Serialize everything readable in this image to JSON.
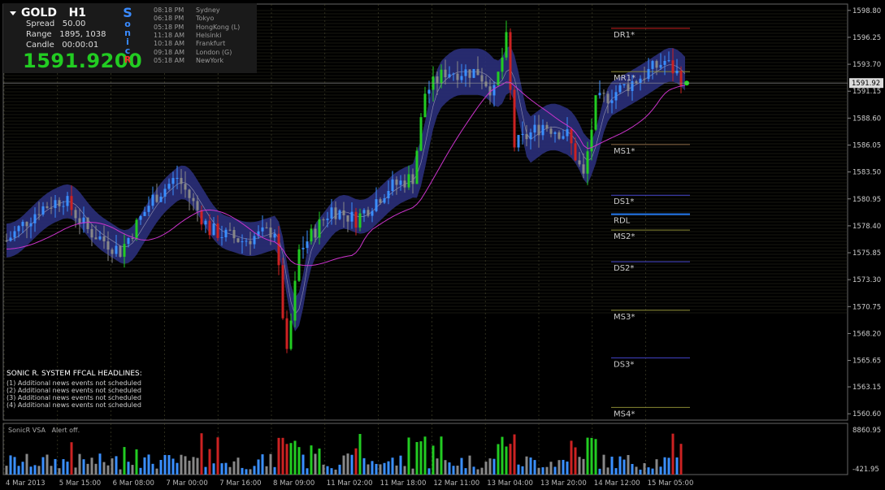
{
  "header": {
    "symbol": "GOLD",
    "timeframe": "H1",
    "spread_label": "Spread",
    "spread_value": "50.00",
    "range_label": "Range",
    "range_value": "1895, 1038",
    "candle_label": "Candle",
    "candle_value": "00:00:01",
    "price": "1591.9200",
    "brand_letters": [
      "S",
      "o",
      "n",
      "i",
      "c",
      "R"
    ]
  },
  "timezones": [
    {
      "time": "08:18 PM",
      "city": "Sydney"
    },
    {
      "time": "06:18 PM",
      "city": "Tokyo"
    },
    {
      "time": "05:18 PM",
      "city": "HongKong  (L)"
    },
    {
      "time": "11:18 AM",
      "city": "Helsinki"
    },
    {
      "time": "10:18 AM",
      "city": "Frankfurt"
    },
    {
      "time": "09:18 AM",
      "city": "London  (G)"
    },
    {
      "time": "05:18 AM",
      "city": "NewYork"
    }
  ],
  "headlines": {
    "title": "SONIC R. SYSTEM  FFCAL HEADLINES:",
    "items": [
      "(1)  Additional news events not scheduled",
      "(2)  Additional news events not scheduled",
      "(3)  Additional news events not scheduled",
      "(4)  Additional news events not scheduled"
    ]
  },
  "indicator": {
    "name": "SonicR VSA",
    "status": "Alert off.",
    "max_label": "8860.95",
    "min_label": "-421.95"
  },
  "chart_data": {
    "type": "candlestick",
    "price_axis_labels": [
      "1598.80",
      "1596.25",
      "1593.70",
      "1591.15",
      "1588.60",
      "1586.05",
      "1583.50",
      "1580.95",
      "1578.40",
      "1575.85",
      "1573.30",
      "1570.75",
      "1568.20",
      "1565.65",
      "1563.15",
      "1560.60"
    ],
    "y_range": [
      1560.0,
      1599.4
    ],
    "current_price_label": "1591.92",
    "time_axis_labels": [
      "4 Mar 2013",
      "5 Mar 15:00",
      "6 Mar 08:00",
      "7 Mar 00:00",
      "7 Mar 16:00",
      "8 Mar 09:00",
      "11 Mar 02:00",
      "11 Mar 18:00",
      "12 Mar 11:00",
      "13 Mar 04:00",
      "13 Mar 20:00",
      "14 Mar 12:00",
      "15 Mar 05:00"
    ],
    "pivot_levels": [
      {
        "label": "DR1*",
        "value": 1597.1,
        "color": "#cc2222"
      },
      {
        "label": "MR1*",
        "value": 1593.0,
        "color": "#888833"
      },
      {
        "label": "MS1*",
        "value": 1586.1,
        "color": "#886644"
      },
      {
        "label": "DS1*",
        "value": 1581.3,
        "color": "#4444cc"
      },
      {
        "label": "RDL",
        "value": 1579.5,
        "color": "#2277ee"
      },
      {
        "label": "MS2*",
        "value": 1578.0,
        "color": "#888833"
      },
      {
        "label": "DS2*",
        "value": 1575.0,
        "color": "#4444cc"
      },
      {
        "label": "MS3*",
        "value": 1570.4,
        "color": "#888833"
      },
      {
        "label": "DS3*",
        "value": 1565.9,
        "color": "#4444cc"
      },
      {
        "label": "MS4*",
        "value": 1561.2,
        "color": "#888833"
      }
    ],
    "colors": {
      "band": "#2a2f7a",
      "ma": "#cc33cc",
      "bull": "#3a8fff",
      "bear": "#cc2222",
      "neutral": "#888888",
      "climax_up": "#22cc22"
    }
  }
}
